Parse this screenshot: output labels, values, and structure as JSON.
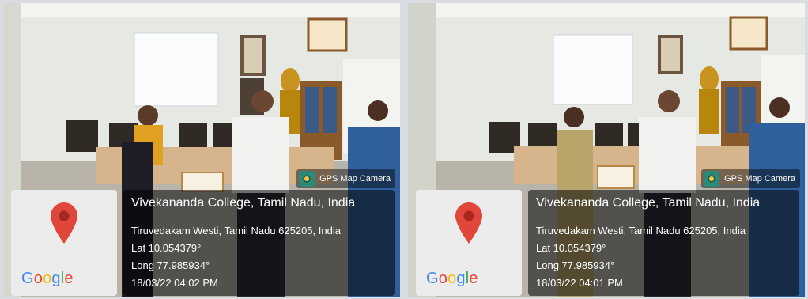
{
  "photos": [
    {
      "gps_tag": "GPS Map Camera",
      "place": "Vivekananda College, Tamil Nadu, India",
      "address": "Tiruvedakam Westi, Tamil Nadu 625205, India",
      "lat": "Lat 10.054379°",
      "long": "Long 77.985934°",
      "datetime": "18/03/22 04:02 PM",
      "map_logo": "Google"
    },
    {
      "gps_tag": "GPS Map Camera",
      "place": "Vivekananda College, Tamil Nadu, India",
      "address": "Tiruvedakam Westi, Tamil Nadu 625205, India",
      "lat": "Lat 10.054379°",
      "long": "Long 77.985934°",
      "datetime": "18/03/22 04:01 PM",
      "map_logo": "Google"
    }
  ],
  "colors": {
    "wall": "#e8eae6",
    "floor": "#b9b7b0",
    "pin": "#e0463a",
    "google_blue": "#4285F4",
    "google_red": "#EA4335",
    "google_yellow": "#FBBC05",
    "google_green": "#34A853"
  }
}
